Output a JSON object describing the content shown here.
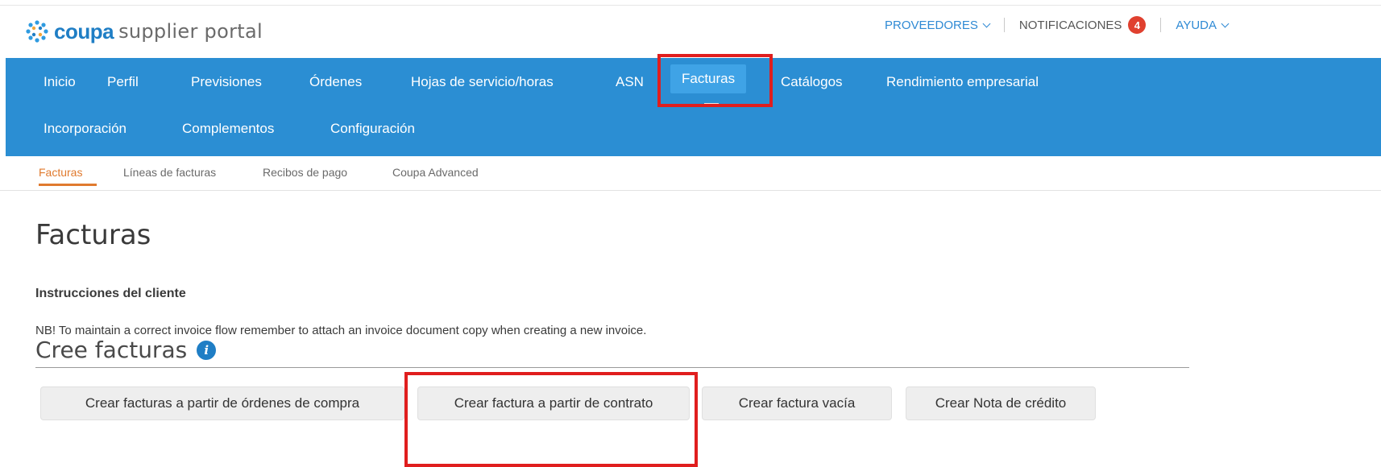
{
  "header": {
    "logo_brand": "coupa",
    "logo_rest": "supplier portal",
    "suppliers_label": "PROVEEDORES",
    "notifications_label": "NOTIFICACIONES",
    "notifications_count": "4",
    "help_label": "AYUDA"
  },
  "nav": {
    "row1": [
      "Inicio",
      "Perfil",
      "Previsiones",
      "Órdenes",
      "Hojas de servicio/horas",
      "ASN",
      "Facturas",
      "Catálogos",
      "Rendimiento empresarial"
    ],
    "row2": [
      "Incorporación",
      "Complementos",
      "Configuración"
    ],
    "active": "Facturas"
  },
  "subnav": {
    "items": [
      "Facturas",
      "Líneas de facturas",
      "Recibos de pago",
      "Coupa Advanced"
    ],
    "active": "Facturas"
  },
  "main": {
    "title": "Facturas",
    "instructions_label": "Instrucciones del cliente",
    "instructions_text": "NB! To maintain a correct invoice flow remember to attach an invoice document copy when creating a new invoice.",
    "create_title": "Cree facturas",
    "info_glyph": "i",
    "buttons": {
      "from_po": "Crear facturas a partir de órdenes de compra",
      "from_contract": "Crear factura a partir de contrato",
      "blank": "Crear factura vacía",
      "credit_note": "Crear Nota de crédito"
    }
  },
  "colors": {
    "nav_blue": "#2b8ed3",
    "highlight_red": "#e01e1e",
    "active_orange": "#e07a2e",
    "badge_red": "#e0402f",
    "link_blue": "#2f8ad4"
  },
  "icons": [
    "coupa-logo-icon",
    "chevron-down-icon",
    "info-icon"
  ]
}
